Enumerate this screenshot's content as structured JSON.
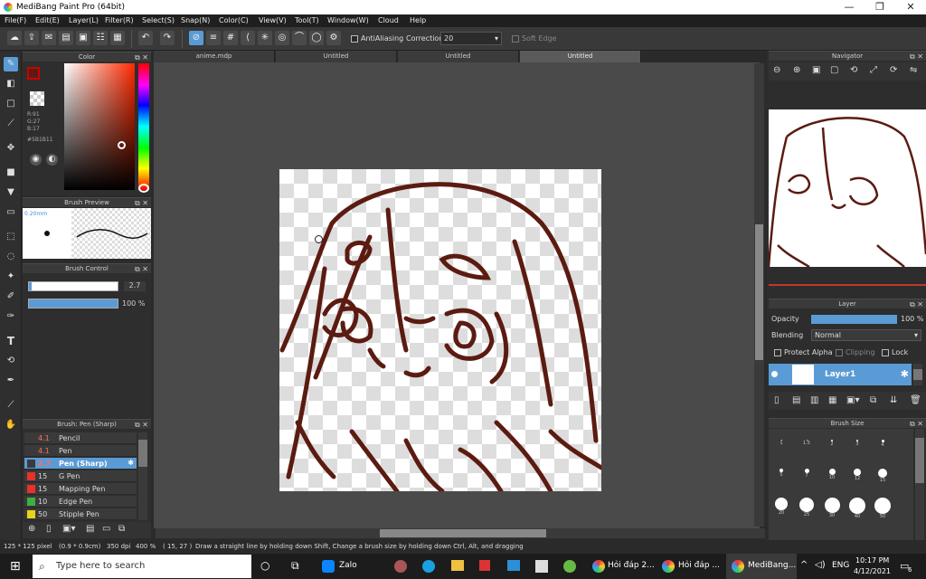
{
  "window": {
    "title": "MediBang Paint Pro (64bit)",
    "min": "—",
    "max": "❐",
    "close": "✕"
  },
  "menu": [
    "File(F)",
    "Edit(E)",
    "Layer(L)",
    "Filter(R)",
    "Select(S)",
    "Snap(N)",
    "Color(C)",
    "View(V)",
    "Tool(T)",
    "Window(W)",
    "Cloud",
    "Help"
  ],
  "toolbar": {
    "antialiasing": "AntiAliasing",
    "correction_label": "Correction",
    "correction_value": "20",
    "soft_edge": "Soft Edge"
  },
  "tabs": [
    "anime.mdp",
    "Untitled",
    "Untitled",
    "Untitled"
  ],
  "color": {
    "title": "Color",
    "r": "R:91",
    "g": "G:27",
    "b": "B:17",
    "hex": "#5B1B11",
    "primary": "#5b1b11"
  },
  "brush_preview": {
    "title": "Brush Preview",
    "size": "0.20mm"
  },
  "brush_control": {
    "title": "Brush Control",
    "size": "2.7",
    "opacity": "100 %"
  },
  "brush_list": {
    "title": "Brush: Pen (Sharp)",
    "items": [
      {
        "size": "4.1",
        "name": "Pencil",
        "color": "#3a3a3a"
      },
      {
        "size": "4.1",
        "name": "Pen",
        "color": "#3a3a3a"
      },
      {
        "size": "2.7",
        "name": "Pen (Sharp)",
        "color": "#3a3a3a",
        "selected": true
      },
      {
        "size": "15",
        "name": "G Pen",
        "color": "#e8312a"
      },
      {
        "size": "15",
        "name": "Mapping Pen",
        "color": "#e8312a"
      },
      {
        "size": "10",
        "name": "Edge Pen",
        "color": "#3cb043"
      },
      {
        "size": "50",
        "name": "Stipple Pen",
        "color": "#e8d31c"
      }
    ]
  },
  "navigator": {
    "title": "Navigator"
  },
  "layer": {
    "title": "Layer",
    "opacity_label": "Opacity",
    "opacity_value": "100 %",
    "blending_label": "Blending",
    "blending_value": "Normal",
    "protect_alpha": "Protect Alpha",
    "clipping": "Clipping",
    "lock": "Lock",
    "layer_name": "Layer1"
  },
  "brush_size": {
    "title": "Brush Size",
    "sizes": [
      [
        "1",
        "1.5",
        "2",
        "3",
        "4"
      ],
      [
        "5",
        "7",
        "10",
        "12",
        "15"
      ],
      [
        "20",
        "25",
        "30",
        "40",
        "50"
      ]
    ]
  },
  "status": {
    "size": "125 * 125 pixel",
    "cm": "(0.9 * 0.9cm)",
    "dpi": "350 dpi",
    "zoom": "400 %",
    "coords": "( 15, 27 )",
    "hint": "Draw a straight line by holding down Shift, Change a brush size by holding down Ctrl, Alt, and dragging"
  },
  "taskbar": {
    "search": "Type here to search",
    "zalo": "Zalo",
    "task1": "Hỏi đáp 2...",
    "task2": "Hỏi đáp ...",
    "task3": "MediBang...",
    "lang": "ENG",
    "time": "10:17 PM",
    "date": "4/12/2021",
    "notif": "6"
  }
}
